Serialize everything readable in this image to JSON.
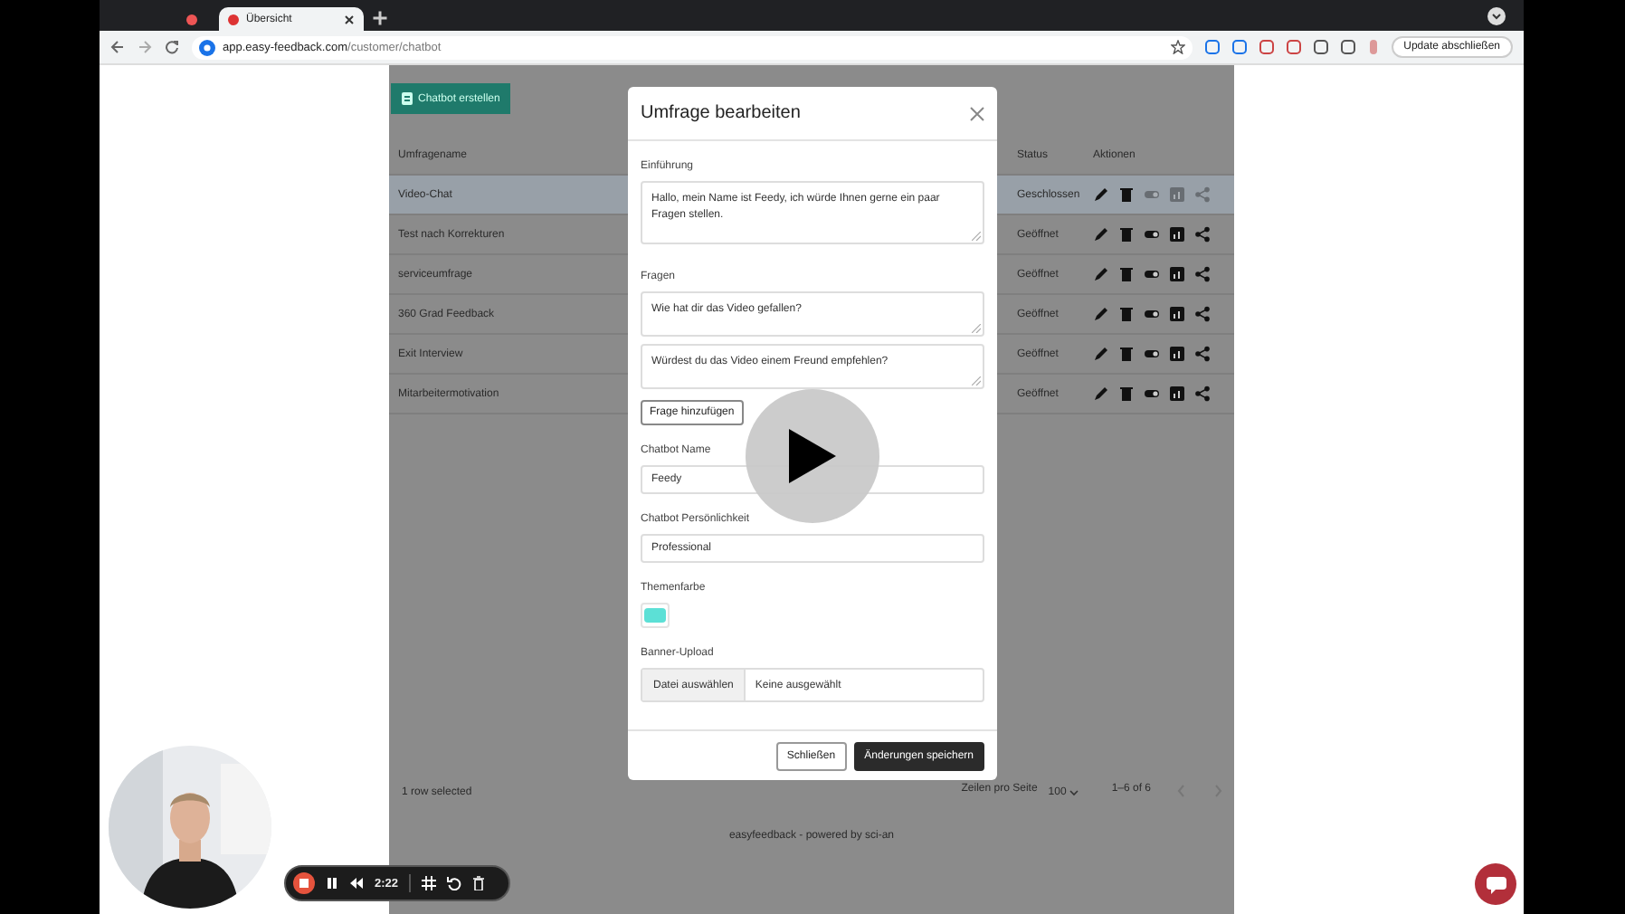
{
  "browser": {
    "tabs": [
      {
        "selected": false
      },
      {
        "title": "Übersicht",
        "selected": true
      }
    ],
    "url_host": "app.easy-feedback.com",
    "url_path": "/customer/chatbot",
    "update_button": "Update abschließen"
  },
  "app": {
    "create_button": "Chatbot erstellen",
    "columns": [
      "Umfragename",
      "Status",
      "Aktionen"
    ],
    "rows": [
      {
        "name": "Video-Chat",
        "status": "Geschlossen",
        "selected": true,
        "active": false
      },
      {
        "name": "Test nach Korrekturen",
        "status": "Geöffnet",
        "selected": false,
        "active": true
      },
      {
        "name": "serviceumfrage",
        "status": "Geöffnet",
        "selected": false,
        "active": true
      },
      {
        "name": "360 Grad Feedback",
        "status": "Geöffnet",
        "selected": false,
        "active": true
      },
      {
        "name": "Exit Interview",
        "status": "Geöffnet",
        "selected": false,
        "active": true
      },
      {
        "name": "Mitarbeitermotivation",
        "status": "Geöffnet",
        "selected": false,
        "active": true
      }
    ],
    "footer": {
      "selection": "1 row selected",
      "rows_per_page_label": "Zeilen pro Seite",
      "rows_per_page": "100",
      "range": "1–6 of 6"
    },
    "credit": "easyfeedback - powered by sci-an"
  },
  "modal": {
    "title": "Umfrage bearbeiten",
    "intro_label": "Einführung",
    "intro": "Hallo, mein Name ist Feedy, ich würde Ihnen gerne ein paar Fragen stellen.",
    "questions_label": "Fragen",
    "questions": [
      "Wie hat dir das Video gefallen?",
      "Würdest du das Video einem Freund empfehlen?"
    ],
    "add_question_button": "Frage hinzufügen",
    "name_label": "Chatbot Name",
    "name": "Feedy",
    "personality_label": "Chatbot Persönlichkeit",
    "personality": "Professional",
    "color_label": "Themenfarbe",
    "banner_label": "Banner-Upload",
    "file_button": "Datei auswählen",
    "file_status": "Keine ausgewählt",
    "buttons": [
      {
        "label": "Schließen",
        "kind": "secondary"
      },
      {
        "label": "Änderungen speichern",
        "kind": "primary"
      }
    ]
  },
  "recorder": {
    "time": "2:22"
  }
}
